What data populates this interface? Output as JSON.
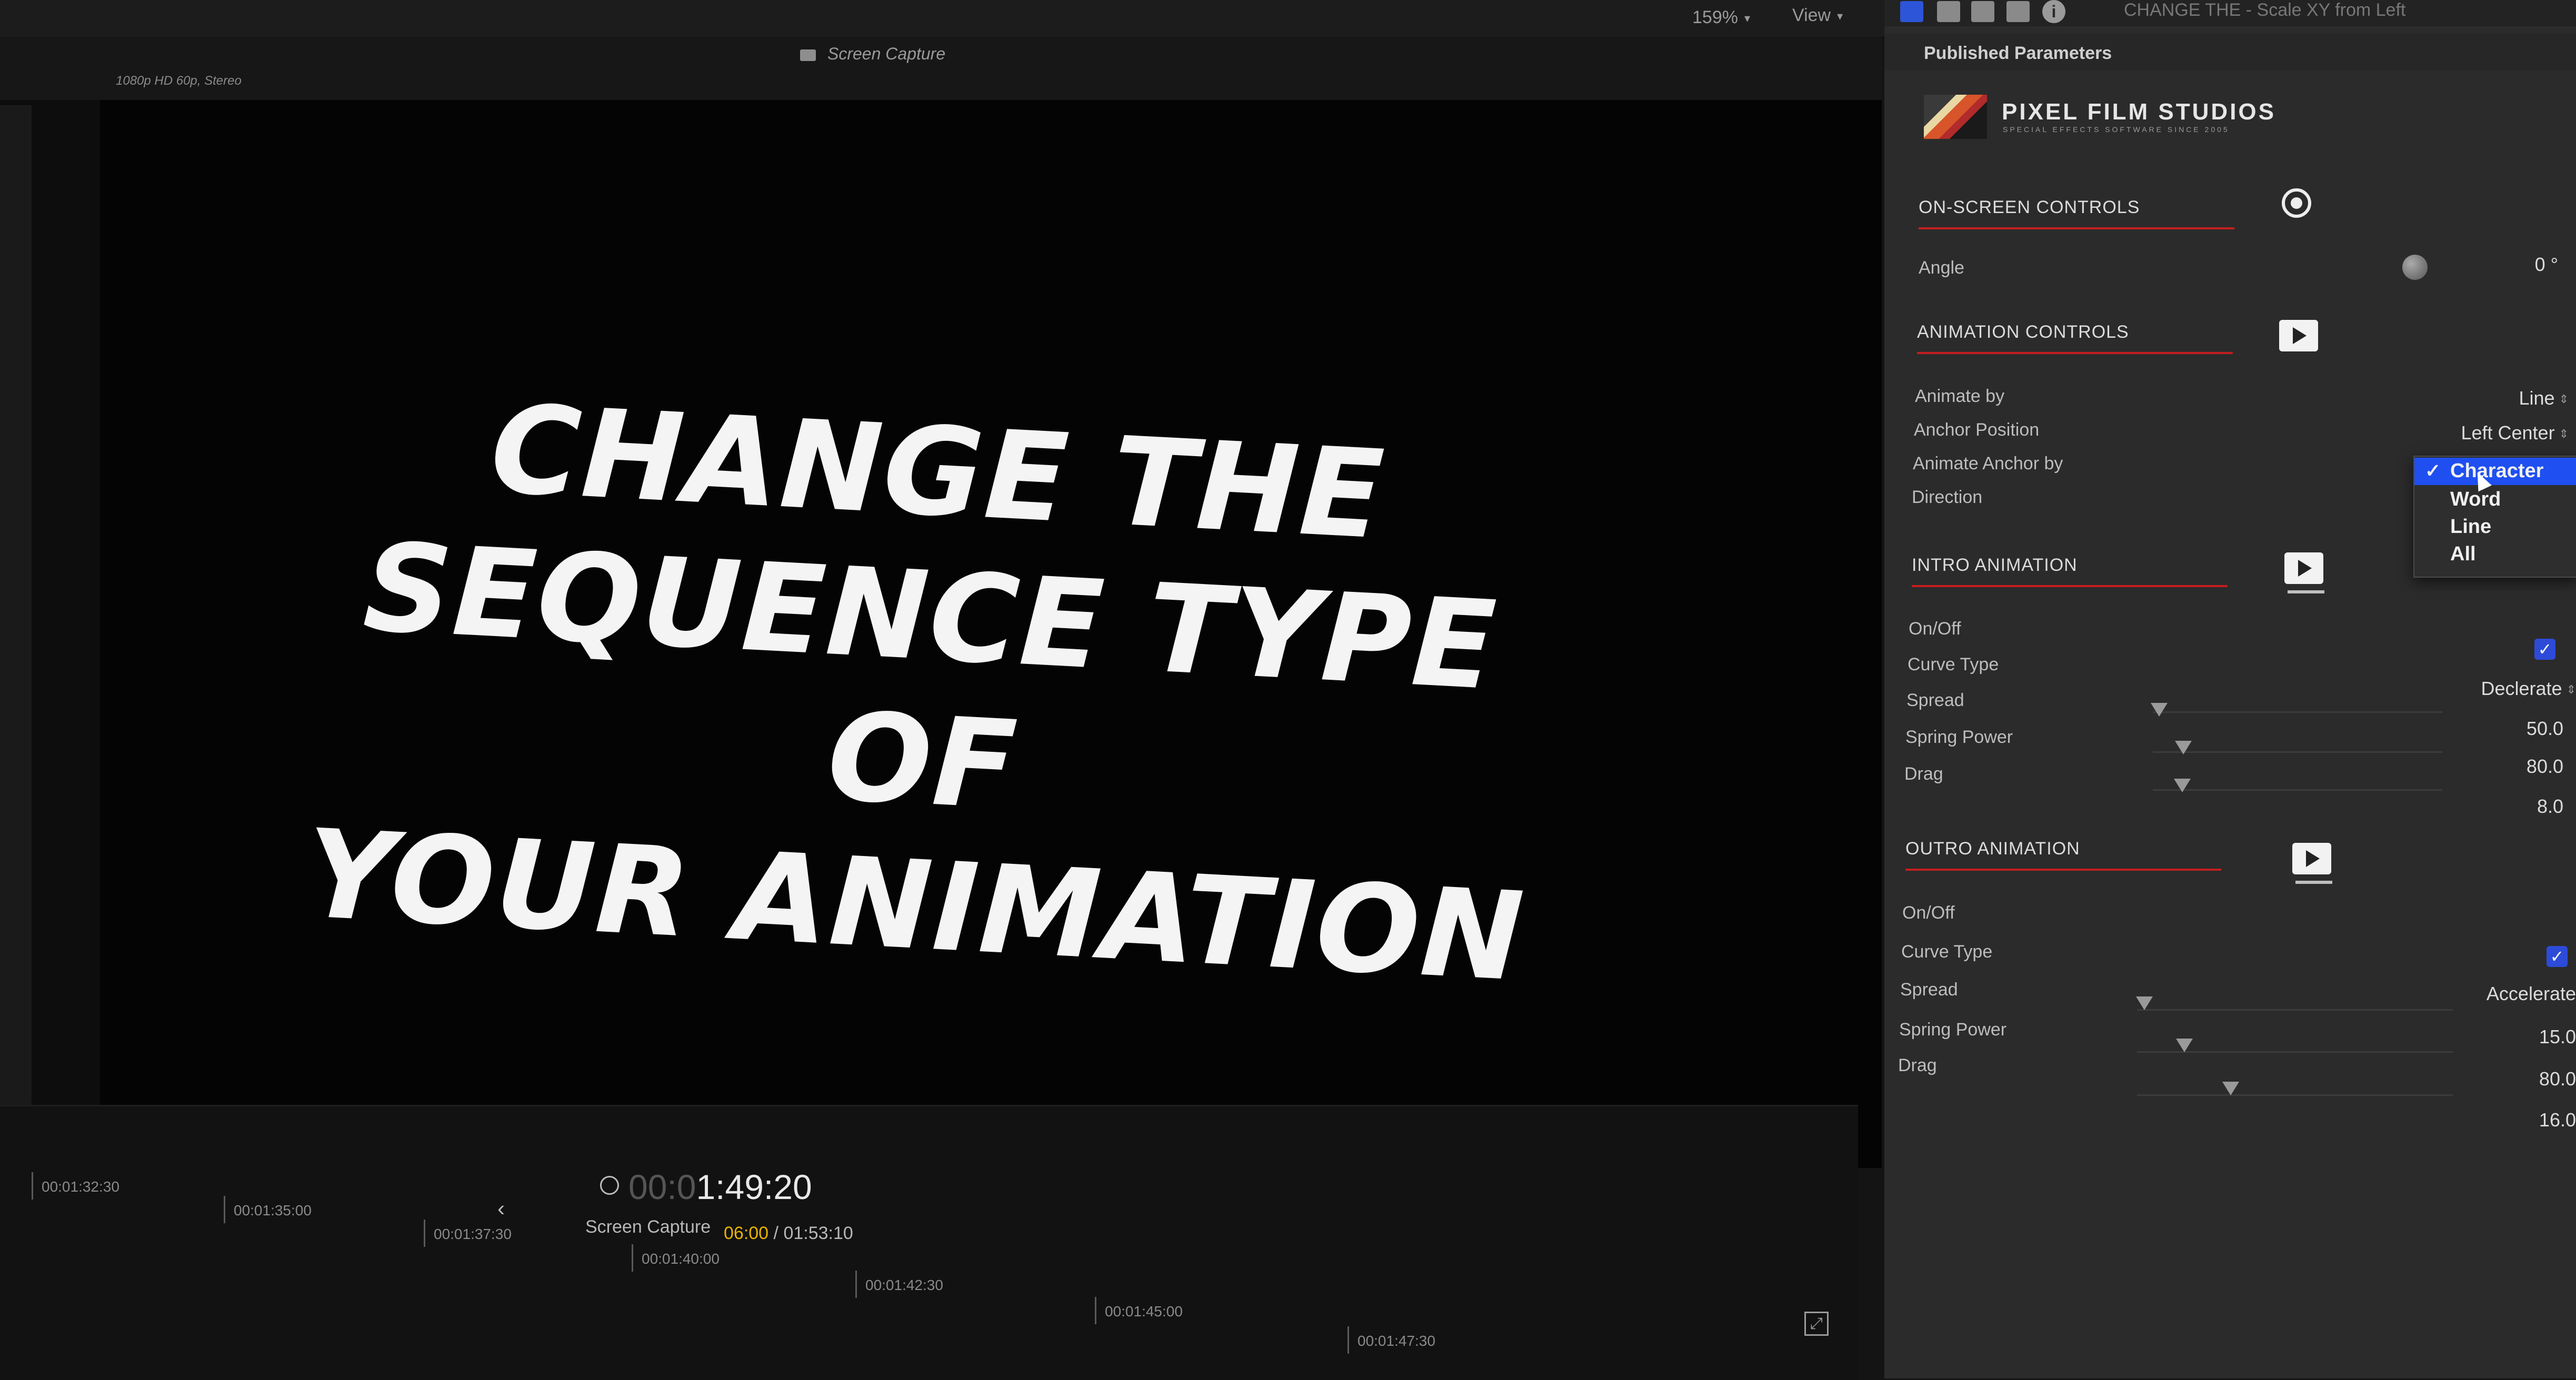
{
  "topbar": {
    "zoom": "159%",
    "view_menu": "View"
  },
  "viewer": {
    "title": "Screen Capture",
    "format_label": "1080p HD 60p, Stereo",
    "headline": [
      "CHANGE THE",
      "SEQUENCE TYPE OF",
      "YOUR ANIMATION"
    ]
  },
  "timeline": {
    "timecode_dim": "00:0",
    "timecode": "1:49:20",
    "clip_title": "Screen Capture",
    "duration_current": "06:00",
    "duration_total": "/ 01:53:10",
    "ruler": [
      "00:01:32:30",
      "00:01:35:00",
      "00:01:37:30",
      "00:01:40:00",
      "00:01:42:30",
      "00:01:45:00",
      "00:01:47:30"
    ]
  },
  "inspector": {
    "title": "CHANGE THE - Scale XY from Left",
    "published_parameters": "Published Parameters",
    "logo": {
      "name": "PIXEL FILM STUDIOS",
      "tagline": "SPECIAL EFFECTS SOFTWARE SINCE 2005"
    },
    "on_screen_controls": {
      "header": "ON-SCREEN CONTROLS",
      "angle_label": "Angle",
      "angle_value": "0 °"
    },
    "animation_controls": {
      "header": "ANIMATION CONTROLS",
      "animate_by_label": "Animate by",
      "animate_by_value": "Line",
      "anchor_position_label": "Anchor Position",
      "anchor_position_value": "Left Center",
      "animate_anchor_label": "Animate Anchor by",
      "direction_label": "Direction"
    },
    "dropdown": {
      "options": [
        "Character",
        "Word",
        "Line",
        "All"
      ],
      "selected": "Character",
      "check": "✓"
    },
    "intro_animation": {
      "header": "INTRO ANIMATION",
      "on_off_label": "On/Off",
      "curve_type_label": "Curve Type",
      "curve_type_value": "Declerate",
      "spread_label": "Spread",
      "spread_value": "50.0",
      "spring_power_label": "Spring Power",
      "spring_power_value": "80.0",
      "drag_label": "Drag",
      "drag_value": "8.0"
    },
    "outro_animation": {
      "header": "OUTRO ANIMATION",
      "on_off_label": "On/Off",
      "curve_type_label": "Curve Type",
      "curve_type_value": "Accelerate",
      "spread_label": "Spread",
      "spread_value": "15.0",
      "spring_power_label": "Spring Power",
      "spring_power_value": "80.0",
      "drag_label": "Drag",
      "drag_value": "16.0"
    }
  },
  "colors": {
    "accent_red": "#c41e1e",
    "selection_blue": "#1f4ff0",
    "timecode_yellow": "#e8b400"
  }
}
